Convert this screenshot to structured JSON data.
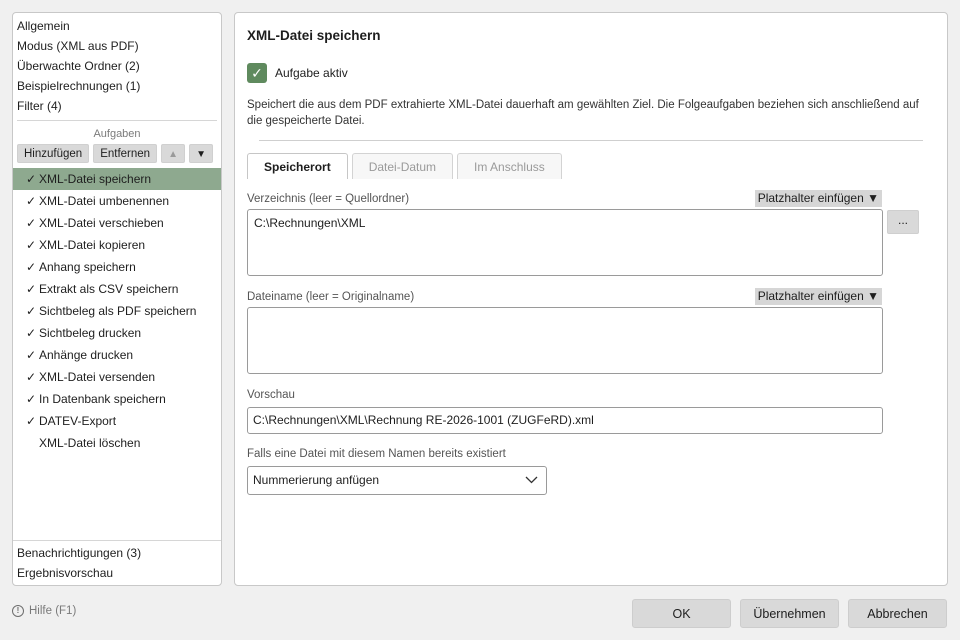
{
  "left_panel": {
    "nav_top": [
      {
        "label": "Allgemein"
      },
      {
        "label": "Modus (XML aus PDF)"
      },
      {
        "label": "Überwachte Ordner (2)"
      },
      {
        "label": "Beispielrechnungen (1)"
      },
      {
        "label": "Filter (4)"
      }
    ],
    "tasks_section": "Aufgaben",
    "toolbar": {
      "add_label": "Hinzufügen",
      "remove_label": "Entfernen",
      "up_glyph": "▲",
      "down_glyph": "▼"
    },
    "tasks": [
      {
        "label": "XML-Datei speichern",
        "checked": "✓",
        "selected": true
      },
      {
        "label": "XML-Datei umbenennen",
        "checked": "✓"
      },
      {
        "label": "XML-Datei verschieben",
        "checked": "✓"
      },
      {
        "label": "XML-Datei kopieren",
        "checked": "✓"
      },
      {
        "label": "Anhang speichern",
        "checked": "✓"
      },
      {
        "label": "Extrakt als CSV speichern",
        "checked": "✓"
      },
      {
        "label": "Sichtbeleg als PDF speichern",
        "checked": "✓"
      },
      {
        "label": "Sichtbeleg drucken",
        "checked": "✓"
      },
      {
        "label": "Anhänge drucken",
        "checked": "✓"
      },
      {
        "label": "XML-Datei versenden",
        "checked": "✓"
      },
      {
        "label": "In Datenbank speichern",
        "checked": "✓"
      },
      {
        "label": "DATEV-Export",
        "checked": "✓"
      },
      {
        "label": "XML-Datei löschen",
        "checked": ""
      }
    ],
    "nav_bottom": [
      {
        "label": "Benachrichtigungen (3)"
      },
      {
        "label": "Ergebnisvorschau"
      }
    ]
  },
  "detail": {
    "title": "XML-Datei speichern",
    "active_checkbox": {
      "label": "Aufgabe aktiv",
      "checked": true,
      "glyph": "✓"
    },
    "description": "Speichert die aus dem PDF extrahierte XML-Datei dauerhaft am gewählten Ziel. Die Folgeaufgaben beziehen sich anschließend auf die gespeicherte Datei.",
    "tabs": [
      {
        "label": "Speicherort",
        "active": true
      },
      {
        "label": "Datei-Datum"
      },
      {
        "label": "Im Anschluss"
      }
    ],
    "directory": {
      "label": "Verzeichnis (leer = Quellordner)",
      "placeholder_button": "Platzhalter einfügen ▼",
      "value": "C:\\Rechnungen\\XML",
      "browse_label": "..."
    },
    "filename": {
      "label": "Dateiname (leer = Originalname)",
      "placeholder_button": "Platzhalter einfügen ▼",
      "value": ""
    },
    "preview": {
      "label": "Vorschau",
      "value": "C:\\Rechnungen\\XML\\Rechnung RE-2026-1001 (ZUGFeRD).xml"
    },
    "conflict": {
      "label": "Falls eine Datei mit diesem Namen bereits existiert",
      "selected": "Nummerierung anfügen"
    }
  },
  "footer": {
    "help_label": "Hilfe (F1)",
    "help_glyph": "!",
    "ok_label": "OK",
    "apply_label": "Übernehmen",
    "cancel_label": "Abbrechen"
  },
  "colors": {
    "accent": "#5f8a5e",
    "selection": "#8ea98f",
    "button": "#d9d9d9"
  }
}
